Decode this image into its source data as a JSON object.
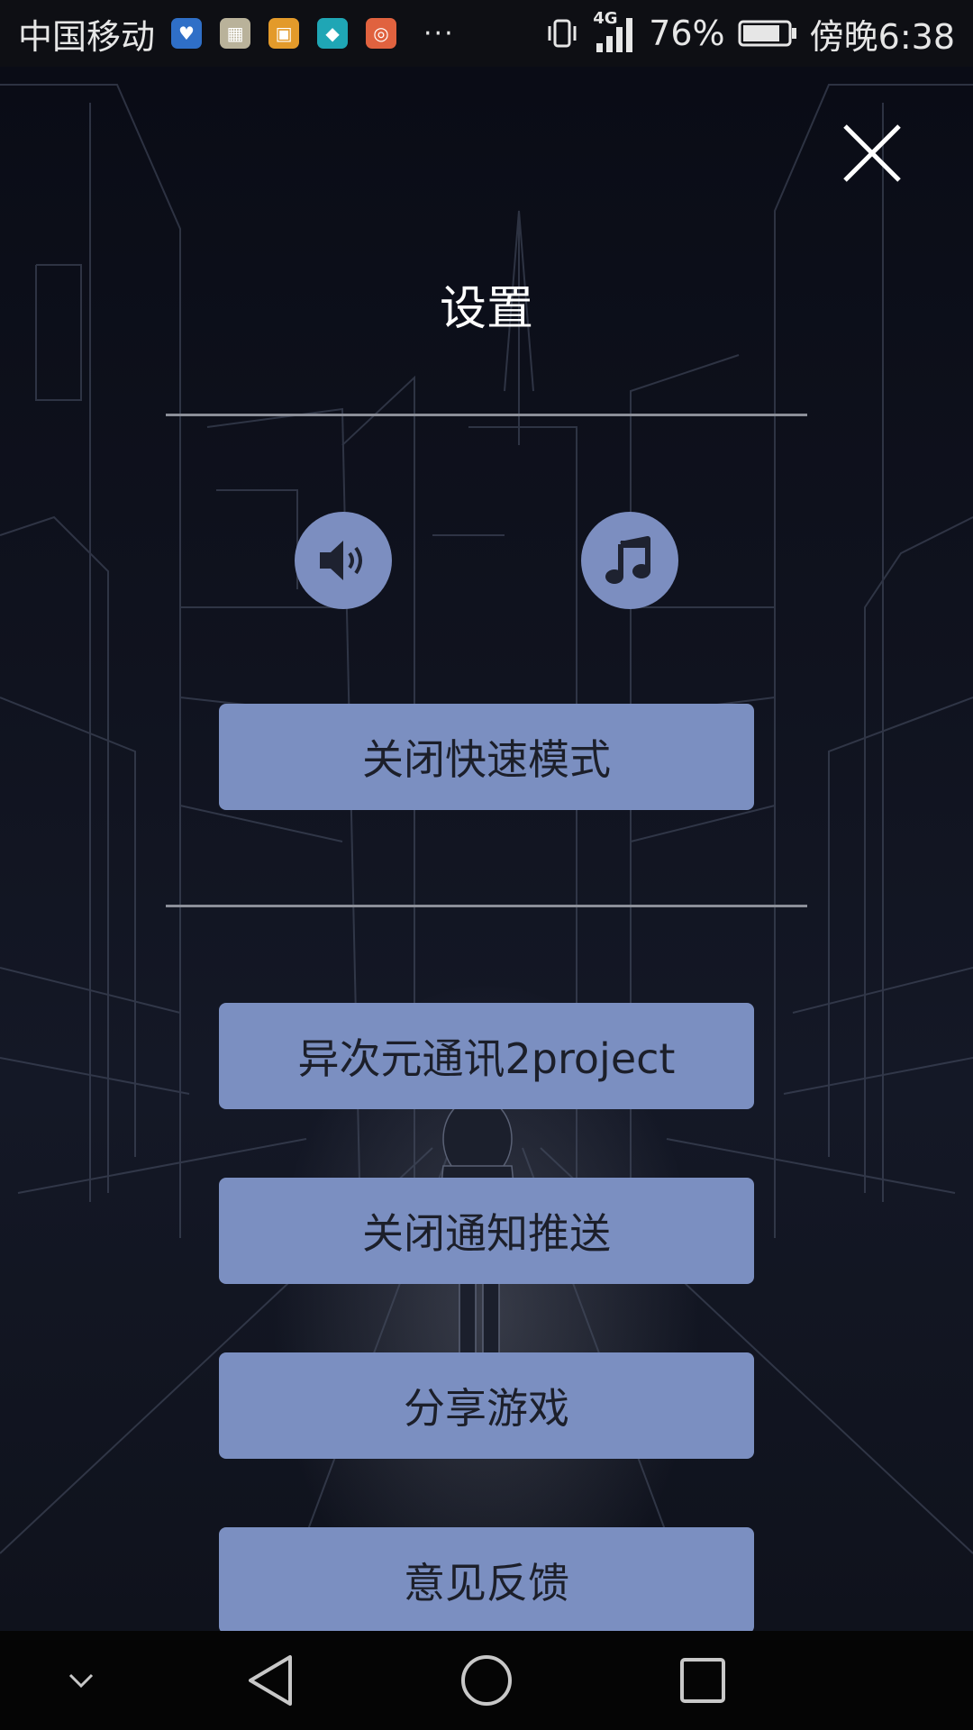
{
  "status_bar": {
    "carrier": "中国移动",
    "more": "···",
    "network_type": "4G",
    "battery_percent": "76%",
    "time": "傍晚6:38",
    "notification_icons": [
      {
        "name": "health-app-icon",
        "color": "#2f6fc7"
      },
      {
        "name": "gallery-app-icon",
        "color": "#b9b29a"
      },
      {
        "name": "lock-app-icon",
        "color": "#e39a2a"
      },
      {
        "name": "shield-app-icon",
        "color": "#1fa6b5"
      },
      {
        "name": "speedometer-app-icon",
        "color": "#e0623f"
      }
    ]
  },
  "settings": {
    "title": "设置",
    "sound_toggle_icon": "speaker-icon",
    "music_toggle_icon": "music-note-icon",
    "fast_mode_label": "关闭快速模式",
    "menu": [
      {
        "label": "异次元通讯2project"
      },
      {
        "label": "关闭通知推送"
      },
      {
        "label": "分享游戏"
      },
      {
        "label": "意见反馈"
      }
    ]
  },
  "colors": {
    "button_fill": "#7b8fc1",
    "button_text": "#1c1f2a",
    "background": "#0a0d16"
  },
  "nav_bar": {
    "icons": [
      "chevron-down-icon",
      "back-icon",
      "home-icon",
      "recents-icon"
    ]
  }
}
